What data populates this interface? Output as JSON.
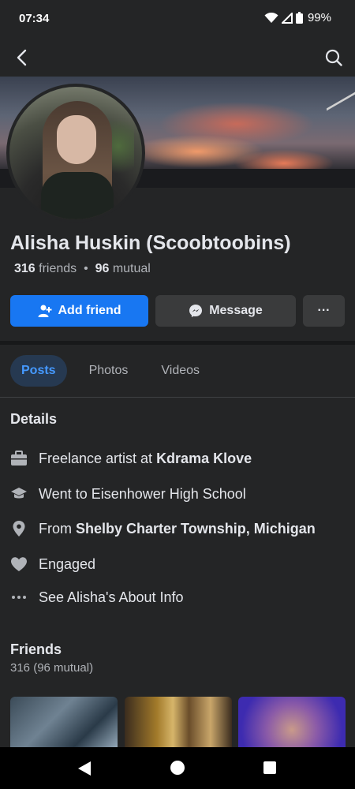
{
  "status_bar": {
    "time": "07:34",
    "battery": "99%"
  },
  "profile": {
    "name": "Alisha Huskin (Scoobtoobins)",
    "friends_count": "316",
    "friends_label": "friends",
    "separator": "•",
    "mutual_count": "96",
    "mutual_label": "mutual"
  },
  "actions": {
    "add_friend": "Add friend",
    "message": "Message",
    "more": "···"
  },
  "tabs": [
    {
      "label": "Posts",
      "active": true
    },
    {
      "label": "Photos",
      "active": false
    },
    {
      "label": "Videos",
      "active": false
    }
  ],
  "details": {
    "title": "Details",
    "work_prefix": "Freelance artist at ",
    "work_place": "Kdrama Klove",
    "education": "Went to Eisenhower High School",
    "from_prefix": "From ",
    "from_place": "Shelby Charter Township, Michigan",
    "relationship": "Engaged",
    "about_link": "See Alisha's About Info"
  },
  "friends_section": {
    "title": "Friends",
    "count_text": "316 (96 mutual)"
  },
  "colors": {
    "accent": "#1877f2",
    "background": "#242526",
    "tab_active_bg": "#263951",
    "tab_active_text": "#4599ff"
  }
}
